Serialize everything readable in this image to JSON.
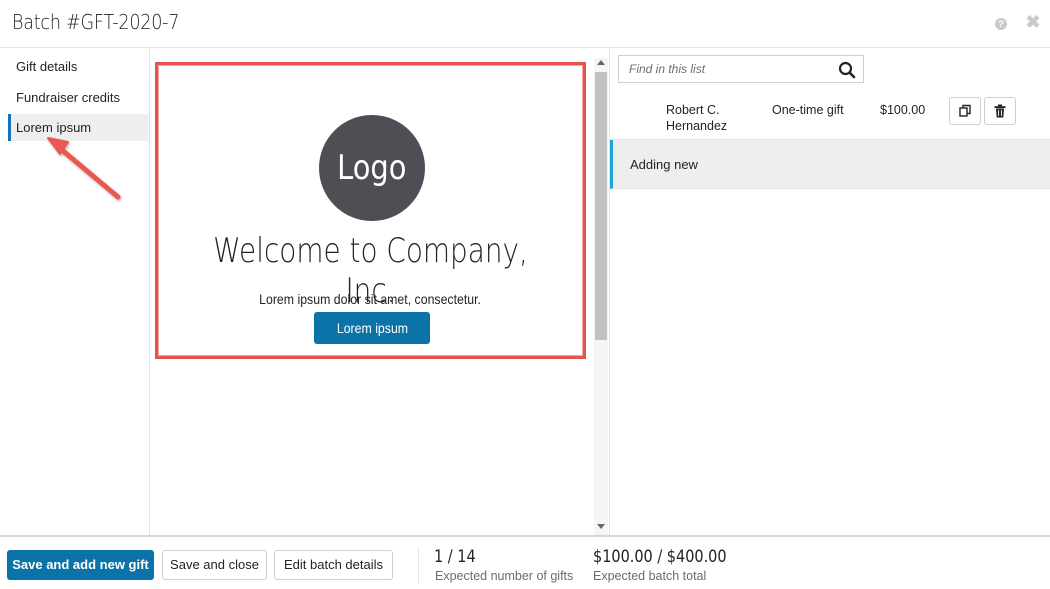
{
  "header": {
    "title": "Batch #GFT-2020-7",
    "help_icon": "?",
    "close_icon": "✖"
  },
  "leftnav": {
    "items": [
      {
        "label": "Gift details"
      },
      {
        "label": "Fundraiser credits"
      },
      {
        "label": "Lorem ipsum",
        "active": true
      }
    ]
  },
  "preview": {
    "logo_text": "Logo",
    "welcome": "Welcome to Company, Inc.",
    "body_text": "Lorem ipsum dolor sit amet, consectetur.",
    "button_label": "Lorem ipsum"
  },
  "list": {
    "search_placeholder": "Find in this list",
    "rows": [
      {
        "name": "Robert C. Hernandez",
        "type": "One-time gift",
        "amount": "$100.00"
      }
    ],
    "adding_label": "Adding new"
  },
  "footer": {
    "save_add_label": "Save and add new gift",
    "save_close_label": "Save and close",
    "edit_batch_label": "Edit batch details",
    "gift_count": "1 / 14",
    "gift_count_label": "Expected number of gifts",
    "batch_total": "$100.00 / $400.00",
    "batch_total_label": "Expected batch total"
  },
  "colors": {
    "primary": "#0b73a7",
    "highlight_border": "#e4534d",
    "active_accent": "#1aa6d9"
  }
}
